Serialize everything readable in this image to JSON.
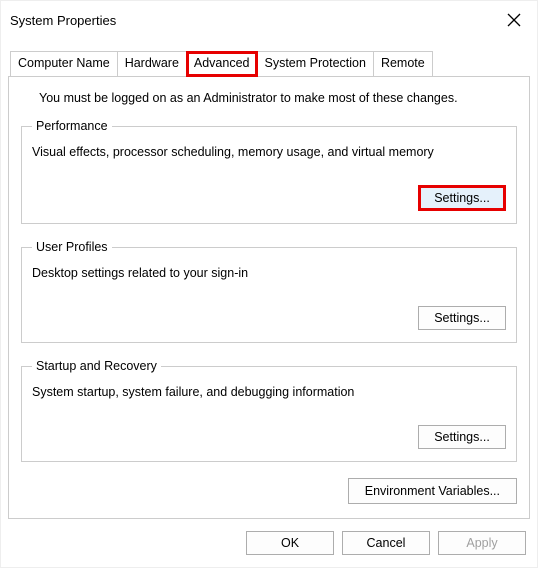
{
  "window": {
    "title": "System Properties"
  },
  "tabs": {
    "computer_name": "Computer Name",
    "hardware": "Hardware",
    "advanced": "Advanced",
    "system_protection": "System Protection",
    "remote": "Remote"
  },
  "content": {
    "notice": "You must be logged on as an Administrator to make most of these changes.",
    "performance": {
      "legend": "Performance",
      "desc": "Visual effects, processor scheduling, memory usage, and virtual memory",
      "button": "Settings..."
    },
    "user_profiles": {
      "legend": "User Profiles",
      "desc": "Desktop settings related to your sign-in",
      "button": "Settings..."
    },
    "startup": {
      "legend": "Startup and Recovery",
      "desc": "System startup, system failure, and debugging information",
      "button": "Settings..."
    },
    "env_button": "Environment Variables..."
  },
  "buttons": {
    "ok": "OK",
    "cancel": "Cancel",
    "apply": "Apply"
  }
}
